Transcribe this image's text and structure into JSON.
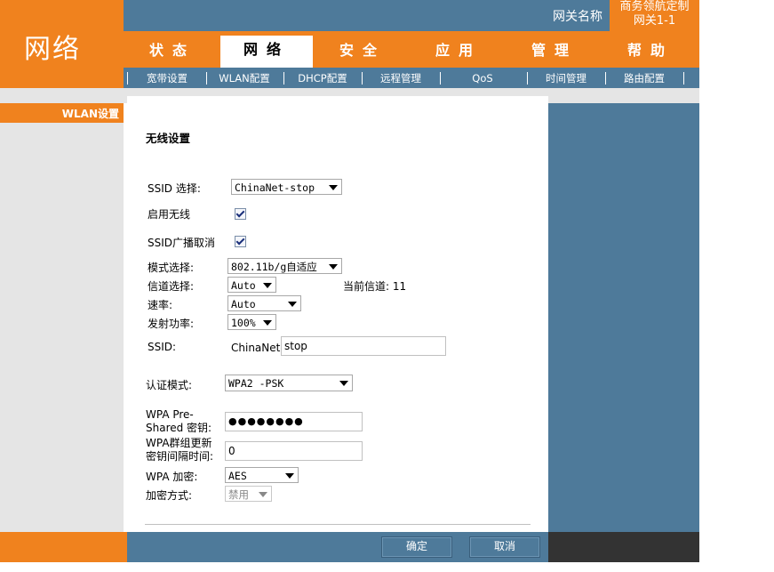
{
  "header": {
    "section_title": "网络",
    "gateway_name_label": "网关名称",
    "gateway_model_line1": "商务领航定制",
    "gateway_model_line2": "网关1-1"
  },
  "tabs": [
    {
      "label": "状态"
    },
    {
      "label": "网络"
    },
    {
      "label": "安全"
    },
    {
      "label": "应用"
    },
    {
      "label": "管理"
    },
    {
      "label": "帮助"
    }
  ],
  "subtabs": [
    {
      "label": "宽带设置"
    },
    {
      "label": "WLAN配置"
    },
    {
      "label": "DHCP配置"
    },
    {
      "label": "远程管理"
    },
    {
      "label": "QoS"
    },
    {
      "label": "时间管理"
    },
    {
      "label": "路由配置"
    }
  ],
  "sidebar": {
    "title": "WLAN设置"
  },
  "form": {
    "heading": "无线设置",
    "ssid_select_label": "SSID 选择:",
    "ssid_select_value": "ChinaNet-stop",
    "enable_wireless_label": "启用无线",
    "ssid_broadcast_cancel_label": "SSID广播取消",
    "mode_label": "模式选择:",
    "mode_value": "802.11b/g自适应",
    "channel_label": "信道选择:",
    "channel_value": "Auto",
    "current_channel_label": "当前信道: 11",
    "rate_label": "速率:",
    "rate_value": "Auto",
    "tx_power_label": "发射功率:",
    "tx_power_value": "100%",
    "ssid_label": "SSID:",
    "ssid_prefix": "ChinaNet-",
    "ssid_value": "stop",
    "auth_mode_label": "认证模式:",
    "auth_mode_value": "WPA2 -PSK",
    "wpa_psk_label_line1": "WPA Pre-",
    "wpa_psk_label_line2": "Shared 密钥:",
    "wpa_psk_value": "●●●●●●●●",
    "wpa_rekey_label_line1": "WPA群组更新",
    "wpa_rekey_label_line2": "密钥间隔时间:",
    "wpa_rekey_value": "0",
    "wpa_encryption_label": "WPA 加密:",
    "wpa_encryption_value": "AES",
    "encryption_method_label": "加密方式:",
    "encryption_method_value": "禁用"
  },
  "buttons": {
    "ok": "确定",
    "cancel": "取消"
  },
  "colors": {
    "accent_orange": "#f0821e",
    "steel_blue": "#4e7a9a",
    "light_gray": "#e5e5e5"
  }
}
